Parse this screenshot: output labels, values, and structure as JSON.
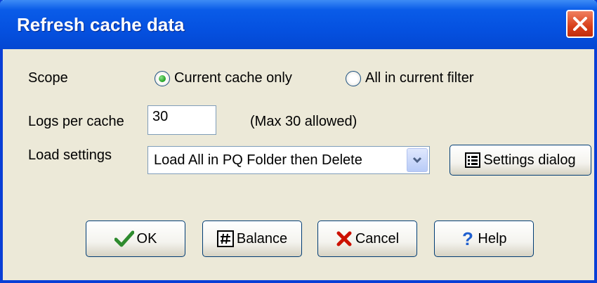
{
  "window": {
    "title": "Refresh cache data"
  },
  "scope": {
    "label": "Scope",
    "options": [
      {
        "label": "Current cache only",
        "selected": true
      },
      {
        "label": "All in current filter",
        "selected": false
      }
    ]
  },
  "logs": {
    "label": "Logs per cache",
    "value": "30",
    "hint": "(Max 30 allowed)"
  },
  "load": {
    "label": "Load settings",
    "selected": "Load All in PQ Folder then Delete",
    "settings_button": "Settings dialog"
  },
  "buttons": {
    "ok": "OK",
    "balance": "Balance",
    "cancel": "Cancel",
    "help": "Help"
  },
  "colors": {
    "title_bar": "#0551e0",
    "dialog_bg": "#ece9d8",
    "ok_check": "#2e8b2e",
    "cancel_x": "#cc1100",
    "help_q": "#1f5fcf"
  },
  "icons": {
    "close": "close-icon",
    "ok": "checkmark-icon",
    "balance": "hash-icon",
    "cancel": "x-icon",
    "help": "question-icon",
    "settings": "list-icon",
    "dropdown": "chevron-down-icon"
  }
}
